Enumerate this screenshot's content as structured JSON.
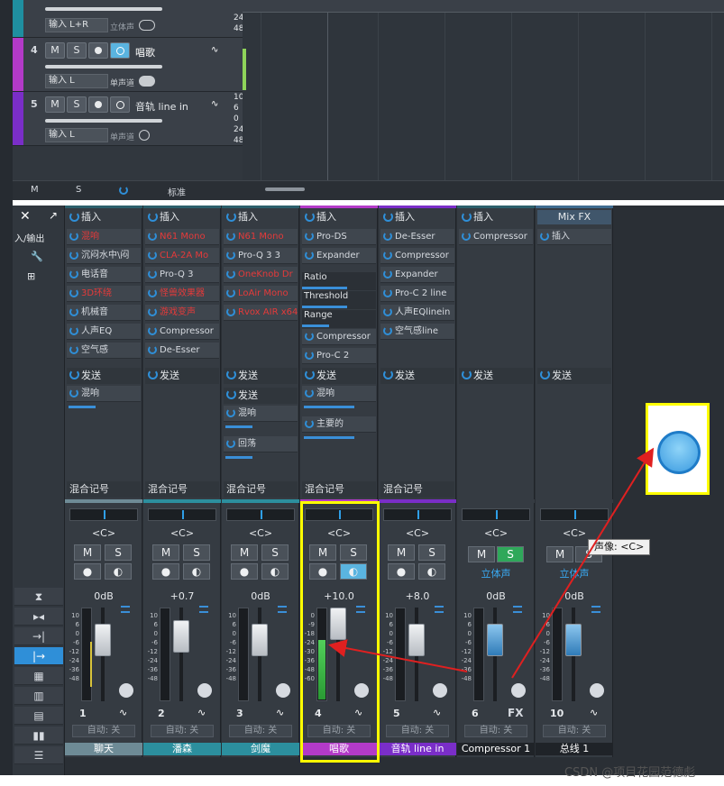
{
  "tracks": [
    {
      "number": "",
      "input": "输入 L+R",
      "mode": "立体声",
      "color": "#1f8fa0"
    },
    {
      "number": "4",
      "name": "唱歌",
      "input": "输入 L",
      "mode": "单声道",
      "color": "#b33ac8"
    },
    {
      "number": "5",
      "name": "音轨 line in",
      "input": "输入 L",
      "mode": "单声道",
      "color": "#7a2ec8"
    }
  ],
  "track_buttons": {
    "mute": "M",
    "solo": "S"
  },
  "track_footer": {
    "m": "M",
    "s": "S",
    "preset": "标准"
  },
  "ruler_numbers": [
    "24",
    "48",
    "10",
    "6",
    "0",
    "24",
    "48"
  ],
  "mixer_side": {
    "io_label": "入/输出"
  },
  "strips": [
    {
      "id": "1",
      "name": "聊天",
      "header": "插入",
      "inserts": [
        {
          "t": "混响",
          "red": true
        },
        {
          "t": "沉闷水中\\闷",
          "red": false
        },
        {
          "t": "电话音",
          "red": false
        },
        {
          "t": "3D环绕",
          "red": true
        },
        {
          "t": "机械音",
          "red": false
        },
        {
          "t": "人声EQ",
          "red": false
        },
        {
          "t": "空气感",
          "red": false
        }
      ],
      "send_header": "发送",
      "sends": [
        "混响"
      ],
      "mix": "混合记号",
      "pan": "<C>",
      "db": "0dB",
      "auto": "自动: 关",
      "color": "#6e8b96"
    },
    {
      "id": "2",
      "name": "潘森",
      "header": "插入",
      "inserts": [
        {
          "t": "N61 Mono",
          "red": true
        },
        {
          "t": "CLA-2A Mo",
          "red": true
        },
        {
          "t": "Pro-Q 3",
          "red": false
        },
        {
          "t": "怪兽效果器",
          "red": true
        },
        {
          "t": "游戏变声",
          "red": true
        },
        {
          "t": "Compressor",
          "red": false
        },
        {
          "t": "De-Esser",
          "red": false
        }
      ],
      "send_header": "发送",
      "sends": [],
      "mix": "混合记号",
      "pan": "<C>",
      "db": "+0.7",
      "auto": "自动: 关",
      "color": "#2c8f9e"
    },
    {
      "id": "3",
      "name": "剑魔",
      "header": "插入",
      "inserts": [
        {
          "t": "N61 Mono",
          "red": true
        },
        {
          "t": "Pro-Q 3 3",
          "red": false
        },
        {
          "t": "OneKnob Dr",
          "red": true
        },
        {
          "t": "LoAir Mono",
          "red": true
        },
        {
          "t": "Rvox AIR x64",
          "red": true
        }
      ],
      "send_header": "发送",
      "sends": [
        "混响",
        "回荡"
      ],
      "mix": "混合记号",
      "pan": "<C>",
      "db": "0dB",
      "auto": "自动: 关",
      "color": "#2c8f9e"
    },
    {
      "id": "4",
      "name": "唱歌",
      "header": "插入",
      "inserts": [
        {
          "t": "Pro-DS",
          "red": false
        },
        {
          "t": "Expander",
          "red": false
        }
      ],
      "params": [
        "Ratio",
        "Threshold",
        "Range"
      ],
      "inserts2": [
        "Compressor",
        "Pro-C 2"
      ],
      "send_header": "发送",
      "sends": [
        "混响",
        "主要的"
      ],
      "mix": "混合记号",
      "pan": "<C>",
      "db": "+10.0",
      "auto": "自动: 关",
      "color": "#b33ac8"
    },
    {
      "id": "5",
      "name": "音轨 line in",
      "header": "插入",
      "inserts": [
        {
          "t": "De-Esser",
          "red": false
        },
        {
          "t": "Compressor",
          "red": false
        },
        {
          "t": "Expander",
          "red": false
        },
        {
          "t": "Pro-C 2 line",
          "red": false
        },
        {
          "t": "人声EQlinein",
          "red": false
        },
        {
          "t": "空气感line",
          "red": false
        }
      ],
      "send_header": "发送",
      "sends": [],
      "mix": "混合记号",
      "pan": "<C>",
      "db": "+8.0",
      "auto": "自动: 关",
      "color": "#7a2ec8"
    },
    {
      "id": "6",
      "name": "Compressor 1",
      "header": "插入",
      "inserts": [
        {
          "t": "Compressor",
          "red": false
        }
      ],
      "send_header": "发送",
      "sends": [],
      "pan": "<C>",
      "mode": "立体声",
      "db": "0dB",
      "auto": "自动: 关",
      "fx": "FX",
      "color": "#353b42"
    },
    {
      "id": "10",
      "name": "总线 1",
      "header": "Mix FX",
      "inserts": [
        {
          "t": "插入",
          "red": false
        }
      ],
      "send_header": "发送",
      "sends": [],
      "pan": "<C>",
      "mode": "立体声",
      "db": "0dB",
      "auto": "自动: 关",
      "color": "#353b42"
    }
  ],
  "fader_scale": [
    "10",
    "6",
    "0",
    "-6",
    "-12",
    "-24",
    "-36",
    "-48"
  ],
  "fader_scale_4": [
    "0",
    "-9",
    "-18",
    "-24",
    "-30",
    "-36",
    "-48",
    "-60"
  ],
  "tooltip": "声像: <C>",
  "watermark": "CSDN @项目花园范德彪",
  "colors": {
    "highlight": "#ffff00",
    "arrow": "#e02020",
    "blue": "#2f8fd8"
  }
}
